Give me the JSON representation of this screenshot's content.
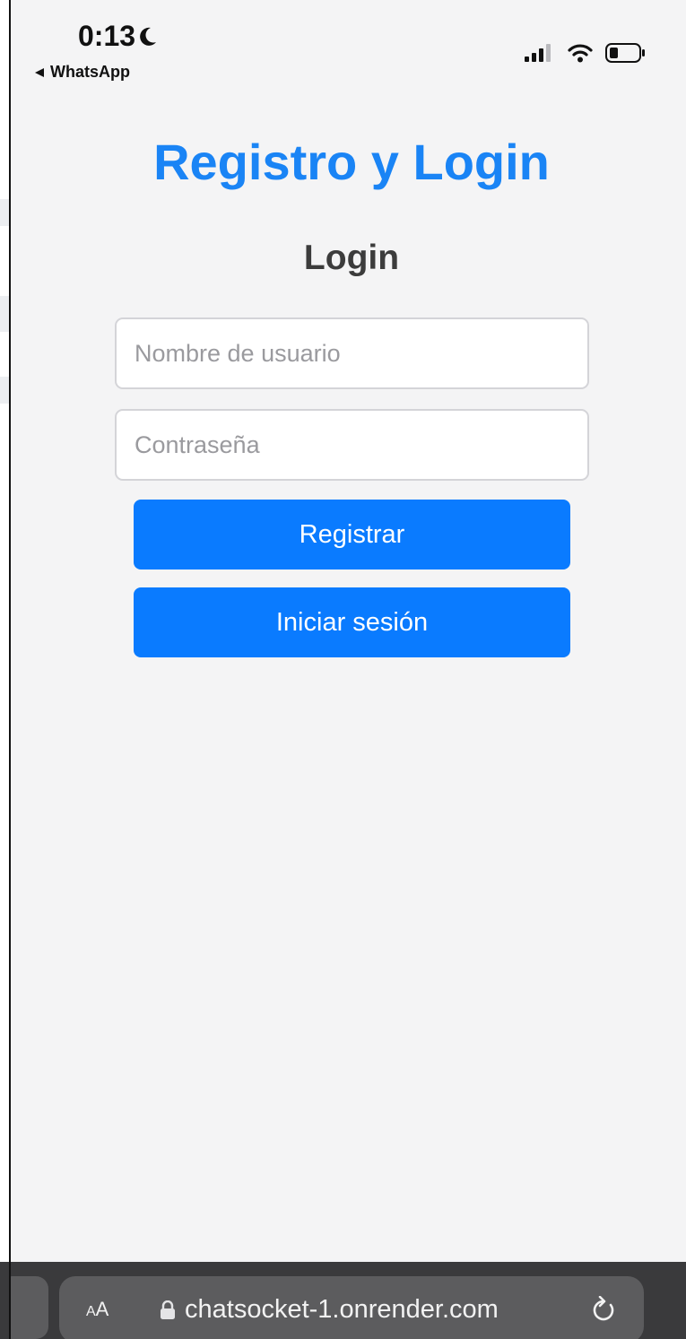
{
  "status_bar": {
    "time": "0:13",
    "back_label": "WhatsApp",
    "icons": [
      "moon-icon",
      "signal-icon",
      "wifi-icon",
      "battery-icon"
    ]
  },
  "page": {
    "title": "Registro y Login",
    "subtitle": "Login",
    "username_placeholder": "Nombre de usuario",
    "password_placeholder": "Contraseña",
    "register_label": "Registrar",
    "login_label": "Iniciar sesión"
  },
  "browser": {
    "text_size_label_big": "A",
    "text_size_label_small": "A",
    "url": "chatsocket-1.onrender.com",
    "icons": [
      "lock-icon",
      "reload-icon"
    ]
  },
  "colors": {
    "title": "#1a84f5",
    "button": "#0a7bff",
    "background": "#f4f4f5",
    "toolbar": "#3a3a3c"
  }
}
